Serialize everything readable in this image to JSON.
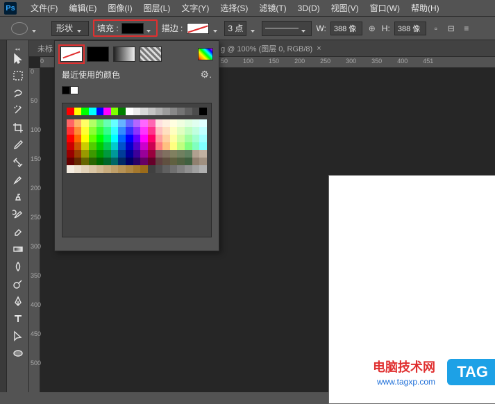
{
  "app": {
    "logo": "Ps"
  },
  "menu": {
    "file": "文件(F)",
    "edit": "编辑(E)",
    "image": "图像(I)",
    "layer": "图层(L)",
    "type": "文字(Y)",
    "select": "选择(S)",
    "filter": "滤镜(T)",
    "threeD": "3D(D)",
    "view": "视图(V)",
    "window": "窗口(W)",
    "help": "帮助(H)"
  },
  "options": {
    "shapeMode": "形状",
    "fillLabel": "填充 :",
    "strokeLabel": "描边 :",
    "strokeWidth": "3 点",
    "wLabel": "W:",
    "wValue": "388 像",
    "hLabel": "H:",
    "hValue": "388 像"
  },
  "tabs": {
    "left": "未标",
    "doc": "g @ 100% (图层 0, RGB/8)",
    "close": "×"
  },
  "rulerH": [
    "0",
    "",
    "",
    "",
    "",
    "",
    "50",
    "",
    "",
    "",
    "",
    "",
    "100",
    "",
    "",
    "150",
    "",
    "",
    "",
    "200",
    "",
    "",
    "250",
    "",
    "",
    "",
    "300",
    "",
    "",
    "350",
    "",
    "",
    "",
    "400",
    "",
    "",
    "451"
  ],
  "rulerV": [
    "0",
    "",
    "50",
    "",
    "100",
    "",
    "150",
    "",
    "200",
    "",
    "250",
    "",
    "300",
    "",
    "350",
    "",
    "400",
    "",
    "450",
    "",
    "500"
  ],
  "colorPanel": {
    "recentLabel": "最近使用的颜色",
    "recent": [
      "#000000",
      "#ffffff"
    ],
    "basicRow": [
      "#ff0000",
      "#ffff00",
      "#00ff00",
      "#00ffff",
      "#0000ff",
      "#ff00ff",
      "#7fff00",
      "#007f00",
      "#ffffff",
      "#ececec",
      "#d8d8d8",
      "#c4c4c4",
      "#b0b0b0",
      "#9c9c9c",
      "#888888",
      "#747474",
      "#606060",
      "#4c4c4c",
      "#000000"
    ],
    "rows": [
      [
        "#ff6666",
        "#ffb366",
        "#ffff66",
        "#b3ff66",
        "#66ff66",
        "#66ffb3",
        "#66ffff",
        "#66b3ff",
        "#6666ff",
        "#b366ff",
        "#ff66ff",
        "#ff66b3",
        "#ffe0e0",
        "#fff0e0",
        "#ffffe0",
        "#f0ffe0",
        "#e0ffe0",
        "#e0fff0",
        "#e0ffff"
      ],
      [
        "#ff3333",
        "#ff8c33",
        "#ffff33",
        "#8cff33",
        "#33ff33",
        "#33ff8c",
        "#33ffff",
        "#338cff",
        "#3333ff",
        "#8c33ff",
        "#ff33ff",
        "#ff338c",
        "#ffc0c0",
        "#ffe0c0",
        "#ffffc0",
        "#e0ffc0",
        "#c0ffc0",
        "#c0ffe0",
        "#c0ffff"
      ],
      [
        "#ff0000",
        "#ff6600",
        "#ffff00",
        "#66ff00",
        "#00ff00",
        "#00ff66",
        "#00ffff",
        "#0066ff",
        "#0000ff",
        "#6600ff",
        "#ff00ff",
        "#ff0066",
        "#ffa0a0",
        "#ffd0a0",
        "#ffffa0",
        "#d0ffa0",
        "#a0ffa0",
        "#a0ffd0",
        "#a0ffff"
      ],
      [
        "#cc0000",
        "#cc5200",
        "#cccc00",
        "#52cc00",
        "#00cc00",
        "#00cc52",
        "#00cccc",
        "#0052cc",
        "#0000cc",
        "#5200cc",
        "#cc00cc",
        "#cc0052",
        "#ff8080",
        "#ffc080",
        "#ffff80",
        "#c0ff80",
        "#80ff80",
        "#80ffc0",
        "#80ffff"
      ],
      [
        "#990000",
        "#993d00",
        "#999900",
        "#3d9900",
        "#009900",
        "#00993d",
        "#009999",
        "#003d99",
        "#000099",
        "#3d0099",
        "#990099",
        "#99003d",
        "#806060",
        "#807060",
        "#808060",
        "#708060",
        "#608060",
        "#b0a090",
        "#c0b0a0"
      ],
      [
        "#660000",
        "#662900",
        "#666600",
        "#296600",
        "#006600",
        "#006629",
        "#006666",
        "#002966",
        "#000066",
        "#290066",
        "#660066",
        "#660029",
        "#604040",
        "#605040",
        "#606040",
        "#506040",
        "#406040",
        "#908070",
        "#a09080"
      ],
      [
        "#f5ede1",
        "#ece0cd",
        "#e3d3b9",
        "#dac6a5",
        "#d1b991",
        "#c8ac7d",
        "#bf9f69",
        "#b69255",
        "#ad8541",
        "#a4782d",
        "#9b6b19",
        "#404040",
        "#505050",
        "#606060",
        "#707070",
        "#808080",
        "#909090",
        "#a0a0a0",
        "#b0b0b0"
      ]
    ]
  },
  "overlay": {
    "title": "电脑技术网",
    "url": "www.tagxp.com",
    "badge": "TAG"
  }
}
